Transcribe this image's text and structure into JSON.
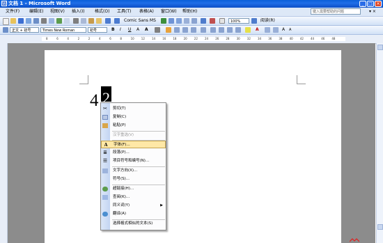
{
  "window": {
    "title": "文档 1 - Microsoft Word"
  },
  "menubar": {
    "items": [
      "文件(F)",
      "编辑(E)",
      "视图(V)",
      "插入(I)",
      "格式(O)",
      "工具(T)",
      "表格(A)",
      "窗口(W)",
      "帮助(H)"
    ],
    "help_placeholder": "键入需要帮助的问题"
  },
  "toolbar_standard": {
    "font_in_bar": "Comic Sans MS",
    "zoom": "100%",
    "read_label": "阅读(R)"
  },
  "toolbar_format": {
    "style": "正文 + 初号",
    "font": "Times New Roman",
    "size": "初号",
    "bold": "B",
    "italic": "I",
    "underline": "U",
    "char_a": "A",
    "scale_a": "A",
    "font_color_a": "A",
    "font_grow": "A",
    "font_shrink": "A"
  },
  "ruler": {
    "numbers": [
      "8",
      "6",
      "4",
      "2",
      "2",
      "4",
      "6",
      "8",
      "10",
      "12",
      "14",
      "16",
      "18",
      "20",
      "22",
      "24",
      "26",
      "28",
      "30",
      "32",
      "34",
      "36",
      "38",
      "40",
      "42",
      "44",
      "46",
      "48"
    ]
  },
  "document": {
    "char_plain": "4",
    "char_selected": "2"
  },
  "context_menu": {
    "items": [
      {
        "label": "剪切(T)",
        "icon": "scissors-icon",
        "enabled": true
      },
      {
        "label": "复制(C)",
        "icon": "copy-icon",
        "enabled": true
      },
      {
        "label": "粘贴(P)",
        "icon": "paste-icon",
        "enabled": true
      },
      {
        "label": "汉字重选(V)",
        "icon": "",
        "enabled": false
      },
      {
        "label": "字体(F)...",
        "icon": "font-icon",
        "enabled": true,
        "highlighted": true
      },
      {
        "label": "段落(P)...",
        "icon": "paragraph-icon",
        "enabled": true
      },
      {
        "label": "项目符号和编号(N)...",
        "icon": "bullets-icon",
        "enabled": true
      },
      {
        "label": "文字方向(X)...",
        "icon": "text-direction-icon",
        "enabled": true
      },
      {
        "label": "符号(S)...",
        "icon": "",
        "enabled": true
      },
      {
        "label": "超链接(H)...",
        "icon": "hyperlink-icon",
        "enabled": true
      },
      {
        "label": "查阅(K)...",
        "icon": "research-icon",
        "enabled": true
      },
      {
        "label": "同义词(Y)",
        "icon": "",
        "enabled": true,
        "submenu": true
      },
      {
        "label": "翻译(A)",
        "icon": "translate-icon",
        "enabled": true
      },
      {
        "label": "选择格式相似的文本(S)",
        "icon": "",
        "enabled": true
      }
    ]
  },
  "colors": {
    "titlebar": "#0b4fc7",
    "highlight": "#ffe8a6",
    "workspace": "#8c8c8c"
  }
}
